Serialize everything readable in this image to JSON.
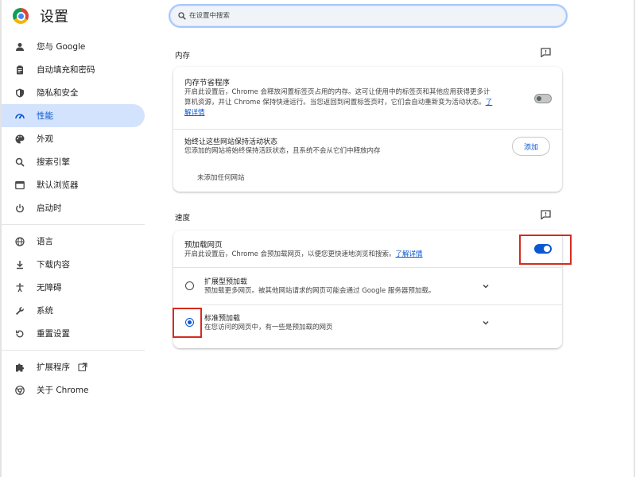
{
  "app": {
    "title": "设置"
  },
  "search": {
    "placeholder": "在设置中搜索"
  },
  "sidebar": {
    "items": [
      {
        "label": "您与 Google",
        "icon": "person-icon"
      },
      {
        "label": "自动填充和密码",
        "icon": "clipboard-icon"
      },
      {
        "label": "隐私和安全",
        "icon": "shield-icon"
      },
      {
        "label": "性能",
        "icon": "speedometer-icon",
        "active": true
      },
      {
        "label": "外观",
        "icon": "palette-icon"
      },
      {
        "label": "搜索引擎",
        "icon": "search-icon"
      },
      {
        "label": "默认浏览器",
        "icon": "browser-icon"
      },
      {
        "label": "启动时",
        "icon": "power-icon"
      },
      {
        "label": "语言",
        "icon": "globe-icon"
      },
      {
        "label": "下载内容",
        "icon": "download-icon"
      },
      {
        "label": "无障碍",
        "icon": "accessibility-icon"
      },
      {
        "label": "系统",
        "icon": "wrench-icon"
      },
      {
        "label": "重置设置",
        "icon": "reset-icon"
      },
      {
        "label": "扩展程序",
        "icon": "puzzle-icon"
      },
      {
        "label": "关于 Chrome",
        "icon": "chrome-icon"
      }
    ]
  },
  "memory": {
    "title": "内存",
    "saver": {
      "title": "内存节省程序",
      "desc_line1": "开启此设置后，Chrome 会释放闲置标签页占用的内存。这可让使用中的标签页和其他应用获得更多计",
      "desc_line2": "算机资源，并让 Chrome 保持快速运行。当您返回到闲置标签页时，它们会自动重新变为活动状态。",
      "link_part1": "了",
      "link_part2": "解详情",
      "enabled": false
    },
    "keep_alive": {
      "title": "始终让这些网站保持活动状态",
      "desc": "您添加的网站将始终保持活跃状态，且系统不会从它们中释放内存",
      "add_label": "添加",
      "empty_label": "未添加任何网站"
    }
  },
  "speed": {
    "title": "速度",
    "preload": {
      "title": "预加载网页",
      "desc": "开启此设置后，Chrome 会预加载网页，以便您更快速地浏览和搜索。",
      "link": "了解详情",
      "enabled": true
    },
    "options": [
      {
        "title": "扩展型预加载",
        "desc": "预加载更多网页。被其他网站请求的网页可能会通过 Google 服务器预加载。",
        "selected": false
      },
      {
        "title": "标准预加载",
        "desc": "在您访问的网页中，有一些是预加载的网页",
        "selected": true
      }
    ]
  },
  "colors": {
    "accent": "#0b57d0",
    "highlight": "#d52b1e",
    "active_nav_bg": "#d3e3fd"
  }
}
